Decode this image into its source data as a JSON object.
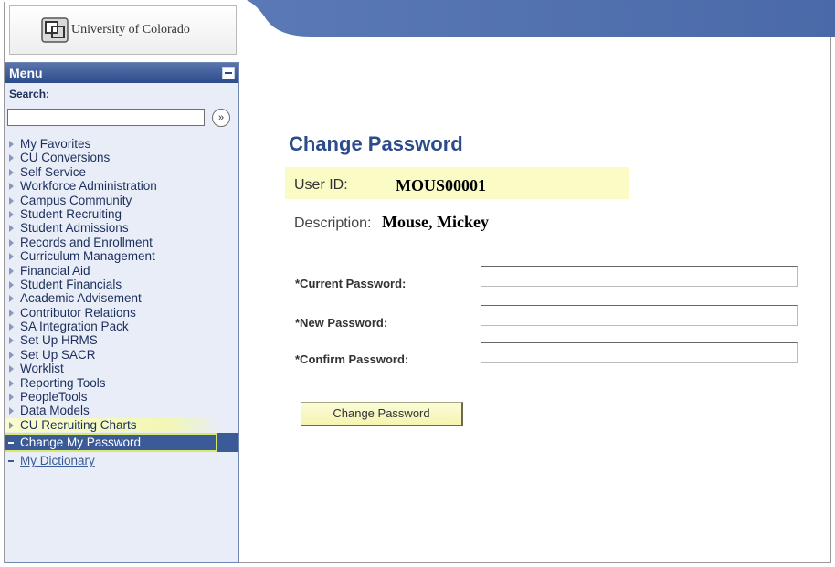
{
  "header": {
    "logo_text": "University of Colorado",
    "banner_color": "#4f6fae"
  },
  "sidebar": {
    "title": "Menu",
    "search_label": "Search:",
    "search_value": "",
    "search_go_icon": "double-chevron-right-icon",
    "items": [
      {
        "label": "My Favorites",
        "type": "folder"
      },
      {
        "label": "CU Conversions",
        "type": "folder"
      },
      {
        "label": "Self Service",
        "type": "folder"
      },
      {
        "label": "Workforce Administration",
        "type": "folder"
      },
      {
        "label": "Campus Community",
        "type": "folder"
      },
      {
        "label": "Student Recruiting",
        "type": "folder"
      },
      {
        "label": "Student Admissions",
        "type": "folder"
      },
      {
        "label": "Records and Enrollment",
        "type": "folder"
      },
      {
        "label": "Curriculum Management",
        "type": "folder"
      },
      {
        "label": "Financial Aid",
        "type": "folder"
      },
      {
        "label": "Student Financials",
        "type": "folder"
      },
      {
        "label": "Academic Advisement",
        "type": "folder"
      },
      {
        "label": "Contributor Relations",
        "type": "folder"
      },
      {
        "label": "SA Integration Pack",
        "type": "folder"
      },
      {
        "label": "Set Up HRMS",
        "type": "folder"
      },
      {
        "label": "Set Up SACR",
        "type": "folder"
      },
      {
        "label": "Worklist",
        "type": "folder"
      },
      {
        "label": "Reporting Tools",
        "type": "folder"
      },
      {
        "label": "PeopleTools",
        "type": "folder"
      },
      {
        "label": "Data Models",
        "type": "folder"
      },
      {
        "label": "CU Recruiting Charts",
        "type": "folder"
      },
      {
        "label": "Change My Password",
        "type": "active"
      },
      {
        "label": "My Dictionary",
        "type": "link"
      }
    ]
  },
  "main": {
    "title": "Change Password",
    "user_id_label": "User ID:",
    "user_id_value": "MOUS00001",
    "description_label": "Description:",
    "description_value": "Mouse, Mickey",
    "fields": [
      {
        "label": "*Current Password:",
        "value": ""
      },
      {
        "label": "*New Password:",
        "value": ""
      },
      {
        "label": "*Confirm Password:",
        "value": ""
      }
    ],
    "submit_label": "Change Password"
  },
  "colors": {
    "menu_header": "#2c4b8a",
    "title_blue": "#2c4b8a",
    "highlight_yellow": "#fbfbc6",
    "button_yellow": "#f5f5b0"
  }
}
